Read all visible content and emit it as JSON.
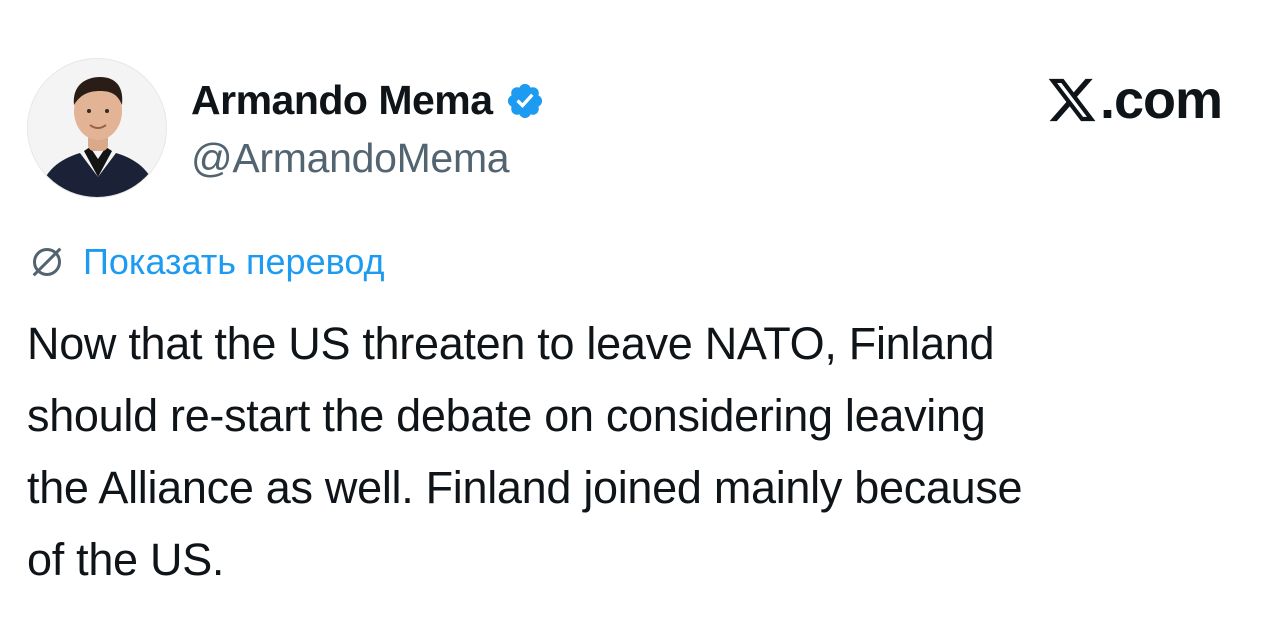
{
  "author": {
    "name": "Armando Mema",
    "handle": "@ArmandoMema",
    "verified": true,
    "avatar_icon": "profile-photo",
    "verified_icon": "verified-badge-icon",
    "verified_color": "#1d9bf0"
  },
  "brand": {
    "icon": "x-logo-icon",
    "suffix": ".com"
  },
  "translate": {
    "icon": "globe-translate-icon",
    "label": "Показать перевод",
    "color": "#1d9bf0"
  },
  "tweet": {
    "text": "Now that the US threaten to leave NATO, Finland\nshould re-start the debate on considering leaving\nthe Alliance as well. Finland joined mainly because\nof the US."
  },
  "colors": {
    "text": "#0f1419",
    "secondary": "#536471",
    "accent": "#1d9bf0",
    "background": "#ffffff"
  }
}
